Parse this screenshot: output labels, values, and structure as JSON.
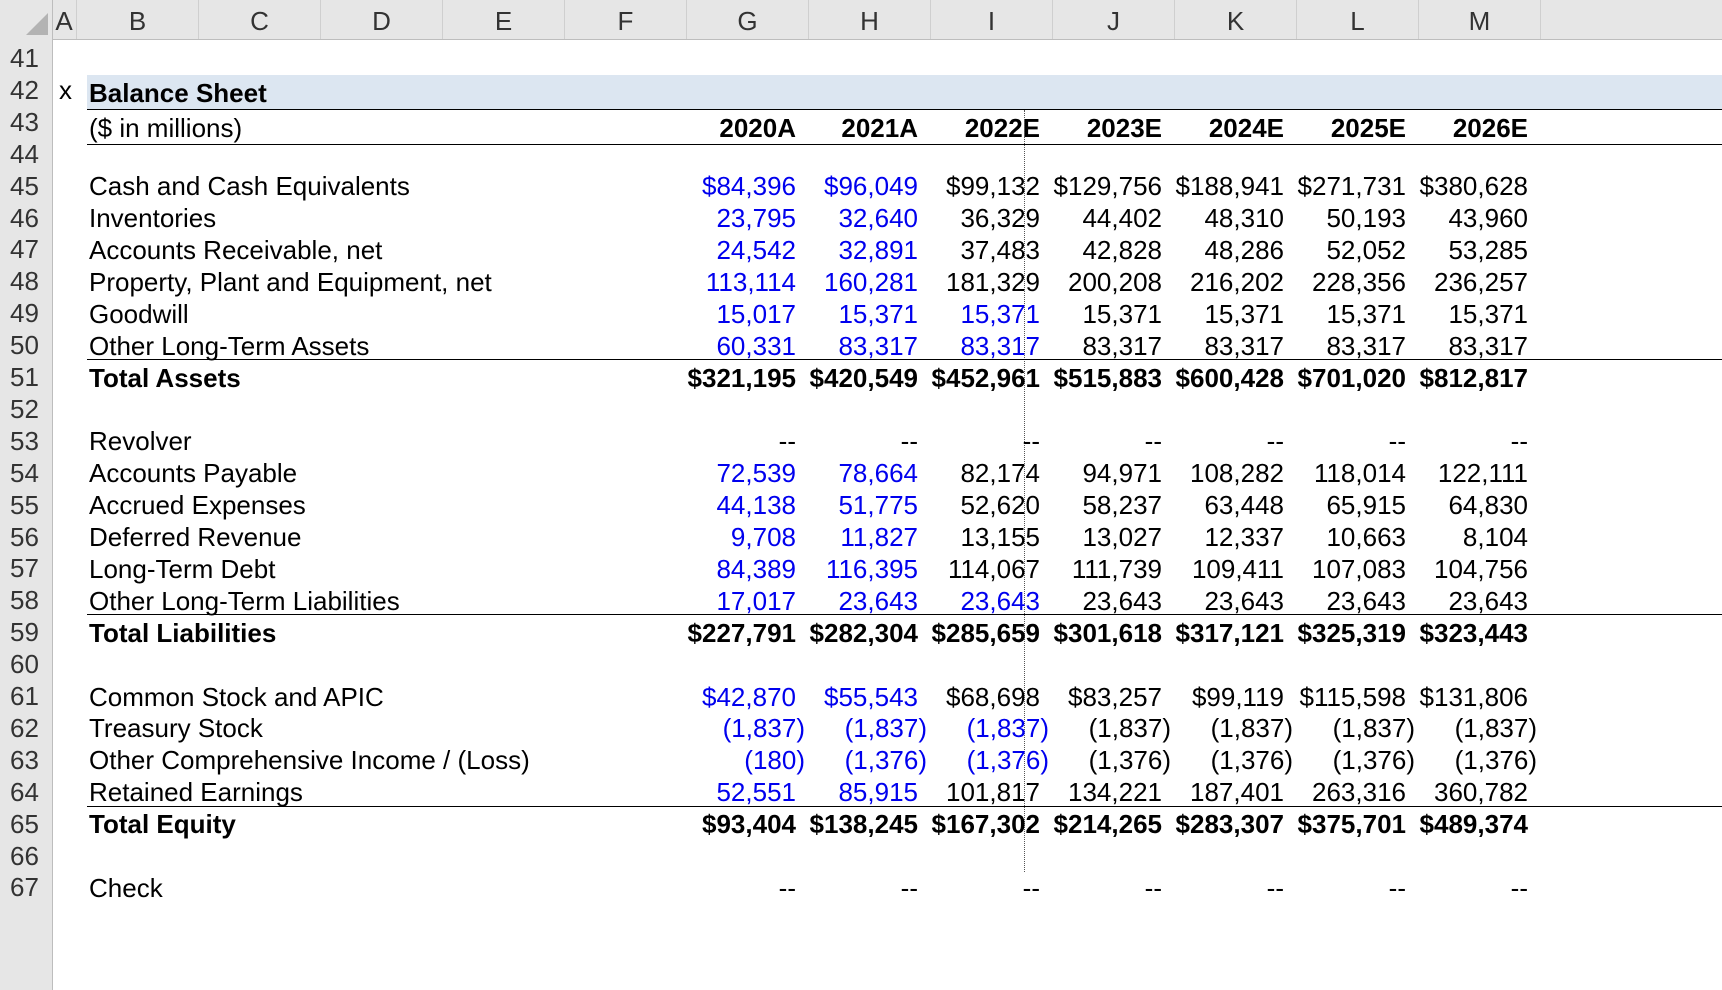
{
  "columns": [
    "A",
    "B",
    "C",
    "D",
    "E",
    "F",
    "G",
    "H",
    "I",
    "J",
    "K",
    "L",
    "M"
  ],
  "rows": [
    41,
    42,
    43,
    44,
    45,
    46,
    47,
    48,
    49,
    50,
    51,
    52,
    53,
    54,
    55,
    56,
    57,
    58,
    59,
    60,
    61,
    62,
    63,
    64,
    65,
    66,
    67
  ],
  "sheet": {
    "row_marker": "x",
    "title": "Balance Sheet",
    "units": "($ in millions)",
    "years": [
      "2020A",
      "2021A",
      "2022E",
      "2023E",
      "2024E",
      "2025E",
      "2026E"
    ],
    "lines": [
      {
        "label": "Cash and Cash Equivalents",
        "values": [
          "$84,396",
          "$96,049",
          "$99,132",
          "$129,756",
          "$188,941",
          "$271,731",
          "$380,628"
        ],
        "blue": [
          true,
          true,
          false,
          false,
          false,
          false,
          false
        ]
      },
      {
        "label": "Inventories",
        "values": [
          "23,795",
          "32,640",
          "36,329",
          "44,402",
          "48,310",
          "50,193",
          "43,960"
        ],
        "blue": [
          true,
          true,
          false,
          false,
          false,
          false,
          false
        ]
      },
      {
        "label": "Accounts Receivable, net",
        "values": [
          "24,542",
          "32,891",
          "37,483",
          "42,828",
          "48,286",
          "52,052",
          "53,285"
        ],
        "blue": [
          true,
          true,
          false,
          false,
          false,
          false,
          false
        ]
      },
      {
        "label": "Property, Plant and Equipment, net",
        "values": [
          "113,114",
          "160,281",
          "181,329",
          "200,208",
          "216,202",
          "228,356",
          "236,257"
        ],
        "blue": [
          true,
          true,
          false,
          false,
          false,
          false,
          false
        ]
      },
      {
        "label": "Goodwill",
        "values": [
          "15,017",
          "15,371",
          "15,371",
          "15,371",
          "15,371",
          "15,371",
          "15,371"
        ],
        "blue": [
          true,
          true,
          true,
          false,
          false,
          false,
          false
        ]
      },
      {
        "label": "Other Long-Term Assets",
        "values": [
          "60,331",
          "83,317",
          "83,317",
          "83,317",
          "83,317",
          "83,317",
          "83,317"
        ],
        "blue": [
          true,
          true,
          true,
          false,
          false,
          false,
          false
        ]
      },
      {
        "label": "Total Assets",
        "values": [
          "$321,195",
          "$420,549",
          "$452,961",
          "$515,883",
          "$600,428",
          "$701,020",
          "$812,817"
        ],
        "total": true
      },
      {
        "label": "",
        "values": []
      },
      {
        "label": "Revolver",
        "values": [
          "--",
          "--",
          "--",
          "--",
          "--",
          "--",
          "--"
        ]
      },
      {
        "label": "Accounts Payable",
        "values": [
          "72,539",
          "78,664",
          "82,174",
          "94,971",
          "108,282",
          "118,014",
          "122,111"
        ],
        "blue": [
          true,
          true,
          false,
          false,
          false,
          false,
          false
        ]
      },
      {
        "label": "Accrued Expenses",
        "values": [
          "44,138",
          "51,775",
          "52,620",
          "58,237",
          "63,448",
          "65,915",
          "64,830"
        ],
        "blue": [
          true,
          true,
          false,
          false,
          false,
          false,
          false
        ]
      },
      {
        "label": "Deferred Revenue",
        "values": [
          "9,708",
          "11,827",
          "13,155",
          "13,027",
          "12,337",
          "10,663",
          "8,104"
        ],
        "blue": [
          true,
          true,
          false,
          false,
          false,
          false,
          false
        ]
      },
      {
        "label": "Long-Term Debt",
        "values": [
          "84,389",
          "116,395",
          "114,067",
          "111,739",
          "109,411",
          "107,083",
          "104,756"
        ],
        "blue": [
          true,
          true,
          false,
          false,
          false,
          false,
          false
        ]
      },
      {
        "label": "Other Long-Term Liabilities",
        "values": [
          "17,017",
          "23,643",
          "23,643",
          "23,643",
          "23,643",
          "23,643",
          "23,643"
        ],
        "blue": [
          true,
          true,
          true,
          false,
          false,
          false,
          false
        ]
      },
      {
        "label": "Total Liabilities",
        "values": [
          "$227,791",
          "$282,304",
          "$285,659",
          "$301,618",
          "$317,121",
          "$325,319",
          "$323,443"
        ],
        "total": true
      },
      {
        "label": "",
        "values": []
      },
      {
        "label": "Common Stock and APIC",
        "values": [
          "$42,870",
          "$55,543",
          "$68,698",
          "$83,257",
          "$99,119",
          "$115,598",
          "$131,806"
        ],
        "blue": [
          true,
          true,
          false,
          false,
          false,
          false,
          false
        ]
      },
      {
        "label": "Treasury Stock",
        "values": [
          "(1,837)",
          "(1,837)",
          "(1,837)",
          "(1,837)",
          "(1,837)",
          "(1,837)",
          "(1,837)"
        ],
        "blue": [
          true,
          true,
          true,
          false,
          false,
          false,
          false
        ]
      },
      {
        "label": "Other Comprehensive Income / (Loss)",
        "values": [
          "(180)",
          "(1,376)",
          "(1,376)",
          "(1,376)",
          "(1,376)",
          "(1,376)",
          "(1,376)"
        ],
        "blue": [
          true,
          true,
          true,
          false,
          false,
          false,
          false
        ]
      },
      {
        "label": "Retained Earnings",
        "values": [
          "52,551",
          "85,915",
          "101,817",
          "134,221",
          "187,401",
          "263,316",
          "360,782"
        ],
        "blue": [
          true,
          true,
          false,
          false,
          false,
          false,
          false
        ]
      },
      {
        "label": "Total Equity",
        "values": [
          "$93,404",
          "$138,245",
          "$167,302",
          "$214,265",
          "$283,307",
          "$375,701",
          "$489,374"
        ],
        "total": true
      },
      {
        "label": "",
        "values": []
      },
      {
        "label": "Check",
        "values": [
          "--",
          "--",
          "--",
          "--",
          "--",
          "--",
          "--"
        ]
      }
    ]
  }
}
